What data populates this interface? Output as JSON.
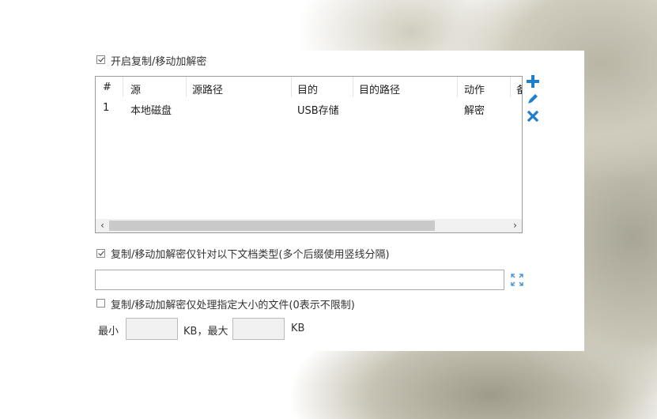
{
  "copy_move": {
    "enable_label": "开启复制/移动加解密",
    "enabled": true,
    "table": {
      "columns": [
        "#",
        "源",
        "源路径",
        "目的",
        "目的路径",
        "动作",
        "备"
      ],
      "rows": [
        {
          "num": "1",
          "source": "本地磁盘",
          "source_path": "",
          "dest": "USB存储",
          "dest_path": "",
          "action": "解密"
        }
      ],
      "scroll_left": "‹",
      "scroll_right": "›"
    },
    "toolbar_icons": [
      "plus-icon",
      "pencil-icon",
      "close-icon"
    ],
    "colors": {
      "icon_blue": "#1e7fd0",
      "border": "#9a9a9a",
      "scroll_thumb": "#c9c9c9"
    }
  },
  "doc_type_filter": {
    "label": "复制/移动加解密仅针对以下文档类型(多个后缀使用竖线分隔)",
    "enabled": true,
    "value": "",
    "expand_icon": "expand-icon"
  },
  "size_filter": {
    "label": "复制/移动加解密仅处理指定大小的文件(0表示不限制)",
    "enabled": false,
    "min_label": "最小",
    "min_value": "",
    "max_label": "KB，最大",
    "max_value": "",
    "unit_label": "KB"
  }
}
